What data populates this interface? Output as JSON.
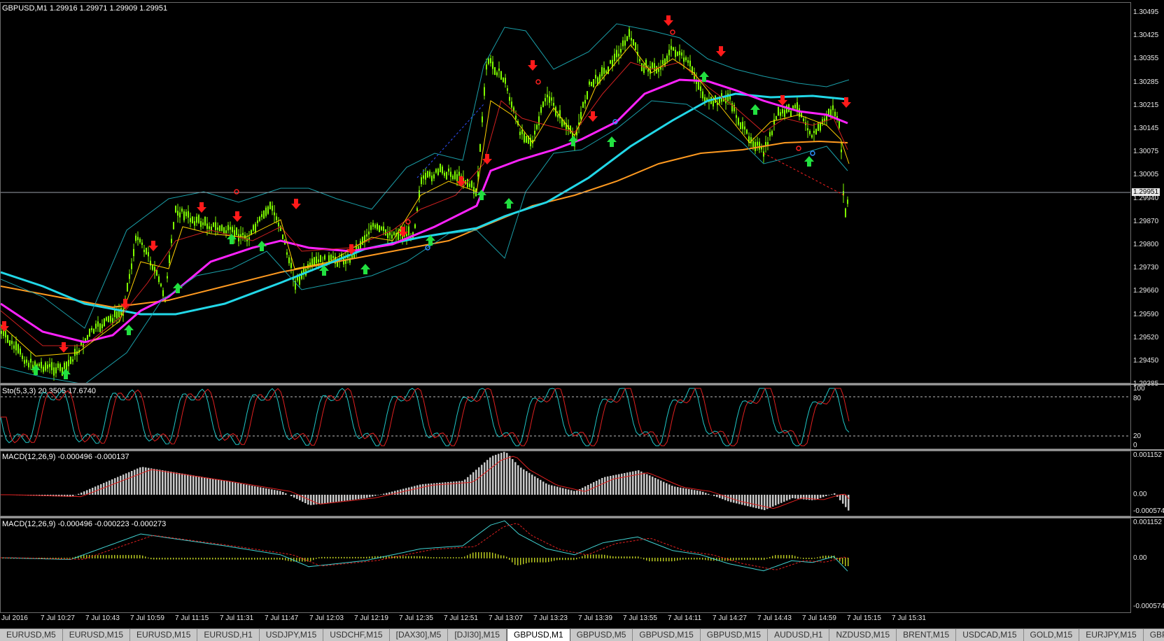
{
  "main": {
    "header": "GBPUSD,M1  1.29916 1.29971 1.29909 1.29951",
    "current_price": "1.29951",
    "price_labels": [
      "1.30495",
      "1.30425",
      "1.30355",
      "1.30285",
      "1.30215",
      "1.30145",
      "1.30075",
      "1.30005",
      "1.29940",
      "1.29870",
      "1.29800",
      "1.29730",
      "1.29660",
      "1.29590",
      "1.29520",
      "1.29450",
      "1.29385"
    ]
  },
  "stoch": {
    "header": "Sto(5,3,3) 20.3505 17.6740",
    "levels": [
      "100",
      "80",
      "20",
      "0"
    ]
  },
  "macd1": {
    "header": "MACD(12,26,9) -0.000496 -0.000137",
    "levels": [
      "0.001152",
      "0.00",
      "-0.000574"
    ]
  },
  "macd2": {
    "header": "MACD(12,26,9) -0.000496 -0.000223 -0.000273",
    "levels": [
      "0.001152",
      "0.00",
      "-0.000574"
    ]
  },
  "time_labels": [
    "Jul 2016",
    "7 Jul 10:27",
    "7 Jul 10:43",
    "7 Jul 10:59",
    "7 Jul 11:15",
    "7 Jul 11:31",
    "7 Jul 11:47",
    "7 Jul 12:03",
    "7 Jul 12:19",
    "7 Jul 12:35",
    "7 Jul 12:51",
    "7 Jul 13:07",
    "7 Jul 13:23",
    "7 Jul 13:39",
    "7 Jul 13:55",
    "7 Jul 14:11",
    "7 Jul 14:27",
    "7 Jul 14:43",
    "7 Jul 14:59",
    "7 Jul 15:15",
    "7 Jul 15:31"
  ],
  "tabs": [
    {
      "label": "EURUSD,M5"
    },
    {
      "label": "EURUSD,M15"
    },
    {
      "label": "EURUSD,M15"
    },
    {
      "label": "EURUSD,H1"
    },
    {
      "label": "USDJPY,M15"
    },
    {
      "label": "USDCHF,M15"
    },
    {
      "label": "[DAX30],M5"
    },
    {
      "label": "[DJI30],M15"
    },
    {
      "label": "GBPUSD,M1",
      "active": true
    },
    {
      "label": "GBPUSD,M5"
    },
    {
      "label": "GBPUSD,M15"
    },
    {
      "label": "GBPUSD,M15"
    },
    {
      "label": "AUDUSD,H1"
    },
    {
      "label": "NZDUSD,M15"
    },
    {
      "label": "BRENT,M15"
    },
    {
      "label": "USDCAD,M15"
    },
    {
      "label": "GOLD,M15"
    },
    {
      "label": "EURJPY,M15"
    },
    {
      "label": "GBP"
    }
  ],
  "colors": {
    "candles": "#7fff00",
    "ma_fast": "#ffd000",
    "ma_red": "#d02020",
    "ma_magenta": "#ff22ff",
    "ma_cyan": "#22d8e8",
    "ma_orange": "#ff9a20",
    "bands": "#1a9ea8",
    "arrow_up": "#22e040",
    "arrow_down": "#ff1a1a"
  }
}
